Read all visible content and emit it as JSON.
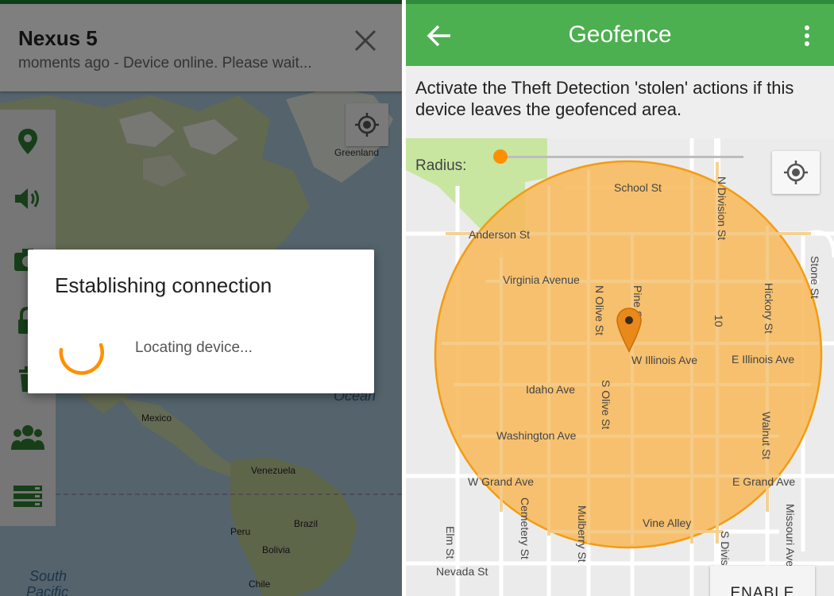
{
  "left_screen": {
    "device": {
      "name": "Nexus 5",
      "status": "moments ago - Device online. Please wait..."
    },
    "map_labels": {
      "greenland": "Greenland",
      "mexico": "Mexico",
      "venezuela": "Venezuela",
      "peru": "Peru",
      "brazil": "Brazil",
      "bolivia": "Bolivia",
      "chile": "Chile",
      "ocean_fragment": "Ocean",
      "south_pacific_line1": "South",
      "south_pacific_line2": "Pacific"
    },
    "side_actions": [
      "location-pin-icon",
      "sound-icon",
      "camera-icon",
      "lock-icon",
      "trash-icon",
      "group-icon",
      "list-icon"
    ],
    "dialog": {
      "title": "Establishing connection",
      "message": "Locating device..."
    },
    "colors": {
      "accent": "#ff8f00",
      "green": "#2e7d32",
      "sea": "#a9c6d9",
      "land": "#c9d6a8"
    }
  },
  "right_screen": {
    "appbar": {
      "title": "Geofence"
    },
    "description": "Activate the Theft Detection 'stolen' actions if this device leaves the geofenced area.",
    "radius": {
      "label": "Radius:",
      "slider_fraction": 0.02
    },
    "streets": {
      "school": "School St",
      "anderson": "Anderson St",
      "virginia": "Virginia Avenue",
      "n_olive": "N Olive St",
      "pine": "Pine St",
      "n_division": "N Division St",
      "hickory": "Hickory St",
      "stone": "Stone St",
      "route": "10",
      "w_illinois": "W Illinois Ave",
      "e_illinois": "E Illinois Ave",
      "idaho": "Idaho Ave",
      "s_olive": "S Olive St",
      "washington": "Washington Ave",
      "walnut": "Walnut St",
      "w_grand": "W Grand Ave",
      "e_grand": "E Grand Ave",
      "cemetery": "Cemetery St",
      "mulberry": "Mulberry St",
      "vine": "Vine Alley",
      "elm": "Elm St",
      "s_division": "S Division St",
      "missouri": "Missouri Ave",
      "nevada": "Nevada St"
    },
    "enable_button": "ENABLE",
    "colors": {
      "appbar": "#4caf50",
      "fence_fill": "#f7b95c",
      "fence_stroke": "#f39c12",
      "park": "#c8e6a0"
    }
  }
}
